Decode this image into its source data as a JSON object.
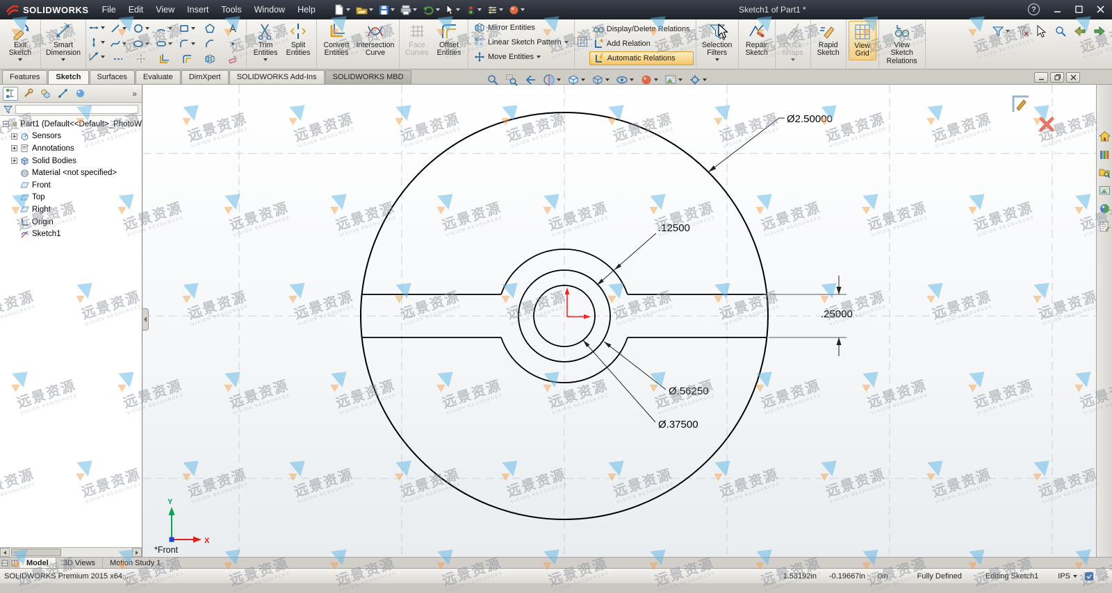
{
  "titlebar": {
    "logo_text": "SOLIDWORKS",
    "menus": [
      {
        "label": "File"
      },
      {
        "label": "Edit"
      },
      {
        "label": "View"
      },
      {
        "label": "Insert"
      },
      {
        "label": "Tools"
      },
      {
        "label": "Window"
      },
      {
        "label": "Help"
      }
    ],
    "quick_tools": [
      "new-document-icon",
      "open-icon",
      "save-icon",
      "print-icon",
      "undo-icon",
      "select-cursor-icon",
      "rebuild-icon",
      "options-icon",
      "edit-appearance-icon"
    ],
    "document_title": "Sketch1 of Part1 *"
  },
  "ribbon": {
    "buttons": {
      "exit_sketch": "Exit Sketch",
      "smart_dimension": "Smart Dimension",
      "trim": "Trim Entities",
      "split": "Split Entities",
      "convert": "Convert Entities",
      "intersection": "Intersection Curve",
      "face_curves": "Face Curves",
      "offset": "Offset Entities",
      "mirror": "Mirror Entities",
      "linear_pattern": "Linear Sketch Pattern",
      "move": "Move Entities",
      "display_delete_relations": "Display/Delete Relations",
      "add_relation": "Add Relation",
      "auto_relations": "Automatic Relations",
      "selection_filters": "Selection Filters",
      "repair_sketch": "Repair Sketch",
      "quick_snaps": "Quick Snaps",
      "rapid_sketch": "Rapid Sketch",
      "view_grid": "View Grid",
      "view_sketch_relations": "View Sketch Relations"
    },
    "highlighted_button": "Automatic Relations",
    "pressed_button": "View Grid",
    "disabled_buttons": [
      "Face Curves",
      "Quick Snaps"
    ]
  },
  "tabs": [
    {
      "label": "Features"
    },
    {
      "label": "Sketch"
    },
    {
      "label": "Surfaces"
    },
    {
      "label": "Evaluate"
    },
    {
      "label": "DimXpert"
    },
    {
      "label": "SOLIDWORKS Add-Ins"
    },
    {
      "label": "SOLIDWORKS MBD"
    }
  ],
  "active_tab": "Sketch",
  "hud_tools": [
    "zoom-fit-icon",
    "zoom-area-icon",
    "previous-view-icon",
    "section-view-icon",
    "view-orientation-icon",
    "display-style-icon",
    "hide-show-items-icon",
    "edit-appearance-icon",
    "apply-scene-icon",
    "view-settings-icon"
  ],
  "feature_tree": {
    "root": "Part1 (Default<<Default>_PhotoW",
    "items": [
      {
        "label": "Sensors"
      },
      {
        "label": "Annotations"
      },
      {
        "label": "Solid Bodies"
      },
      {
        "label": "Material <not specified>"
      },
      {
        "label": "Front"
      },
      {
        "label": "Top"
      },
      {
        "label": "Right"
      },
      {
        "label": "Origin"
      },
      {
        "label": "Sketch1"
      }
    ]
  },
  "viewport": {
    "view_label": "*Front",
    "axis_x": "X",
    "axis_y": "Y",
    "dims": {
      "outer": "Ø2.50000",
      "gap": ".12500",
      "slot": ".25000",
      "hub_outer": "Ø.56250",
      "hub_inner": "Ø.37500"
    }
  },
  "task_pane": [
    "solidworks-resources-icon",
    "design-library-icon",
    "file-explorer-icon",
    "view-palette-icon",
    "appearances-scenes-icon",
    "custom-properties-icon"
  ],
  "doc_tabs": [
    {
      "label": "Model"
    },
    {
      "label": "3D Views"
    },
    {
      "label": "Motion Study 1"
    }
  ],
  "statusbar": {
    "app_info": "SOLIDWORKS Premium 2015 x64...",
    "x": "1.53192in",
    "y": "-0.19667in",
    "z": "0in",
    "state": "Fully Defined",
    "mode": "Editing Sketch1",
    "units": "IPS"
  },
  "watermark": {
    "cn": "远景资源",
    "en": "VISION RESOURCES"
  },
  "colors": {
    "highlight_orange": "#f6c563",
    "sketch_line": "#000000",
    "origin_red": "#ff2020",
    "axis_y_green": "#00a651",
    "axis_x_red": "#e02020",
    "watermark_blue": "#5fb7e6",
    "watermark_orange": "#f1a352"
  }
}
